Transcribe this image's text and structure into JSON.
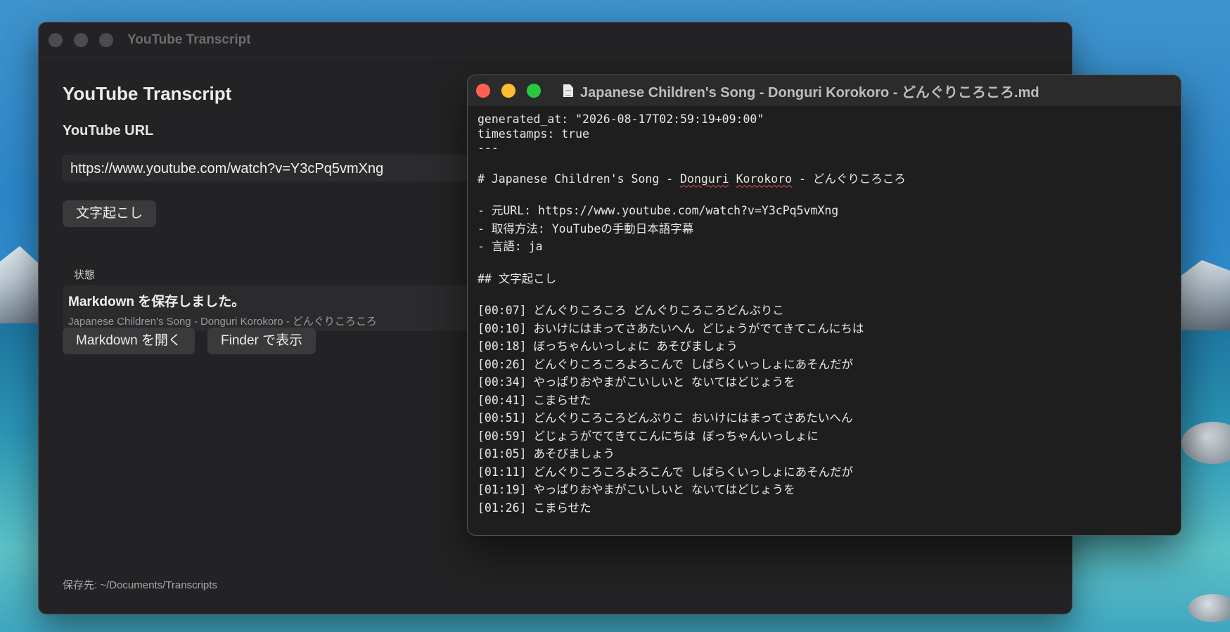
{
  "main_window": {
    "window_title": "YouTube Transcript",
    "app_title": "YouTube Transcript",
    "url_label": "YouTube URL",
    "url_value": "https://www.youtube.com/watch?v=Y3cPq5vmXng",
    "transcribe_button": "文字起こし",
    "status_label": "状態",
    "status_message": "Markdown を保存しました。",
    "status_detail": "Japanese Children's Song - Donguri Korokoro - どんぐりころころ",
    "open_markdown_button": "Markdown を開く",
    "show_in_finder_button": "Finder で表示",
    "save_path": "保存先: ~/Documents/Transcripts"
  },
  "editor_window": {
    "window_title": "Japanese Children's Song - Donguri Korokoro - どんぐりころころ.md",
    "frontmatter": [
      "generated_at: \"2026-08-17T02:59:19+09:00\"",
      "timestamps: true",
      "---"
    ],
    "heading_prefix": "# Japanese Children's Song - ",
    "heading_misspelled_1": "Donguri",
    "heading_misspelled_2": "Korokoro",
    "heading_suffix": " - どんぐりころころ",
    "meta": [
      "- 元URL: https://www.youtube.com/watch?v=Y3cPq5vmXng",
      "- 取得方法: YouTubeの手動日本語字幕",
      "- 言語: ja"
    ],
    "section_heading": "## 文字起こし",
    "transcript": [
      "[00:07] どんぐりころころ どんぐりころころどんぶりこ",
      "[00:10] おいけにはまってさあたいへん どじょうがでてきてこんにちは",
      "[00:18] ぼっちゃんいっしょに あそびましょう",
      "[00:26] どんぐりころころよろこんで しばらくいっしょにあそんだが",
      "[00:34] やっぱりおやまがこいしいと ないてはどじょうを",
      "[00:41] こまらせた",
      "[00:51] どんぐりころころどんぶりこ おいけにはまってさあたいへん",
      "[00:59] どじょうがでてきてこんにちは ぼっちゃんいっしょに",
      "[01:05] あそびましょう",
      "[01:11] どんぐりころころよろこんで しばらくいっしょにあそんだが",
      "[01:19] やっぱりおやまがこいしいと ないてはどじょうを",
      "[01:26] こまらせた"
    ]
  },
  "colors": {
    "close": "#ff5f57",
    "minimize": "#febc2e",
    "zoom": "#28c840",
    "window_bg": "#232325",
    "editor_bg": "#1e1e1e"
  }
}
